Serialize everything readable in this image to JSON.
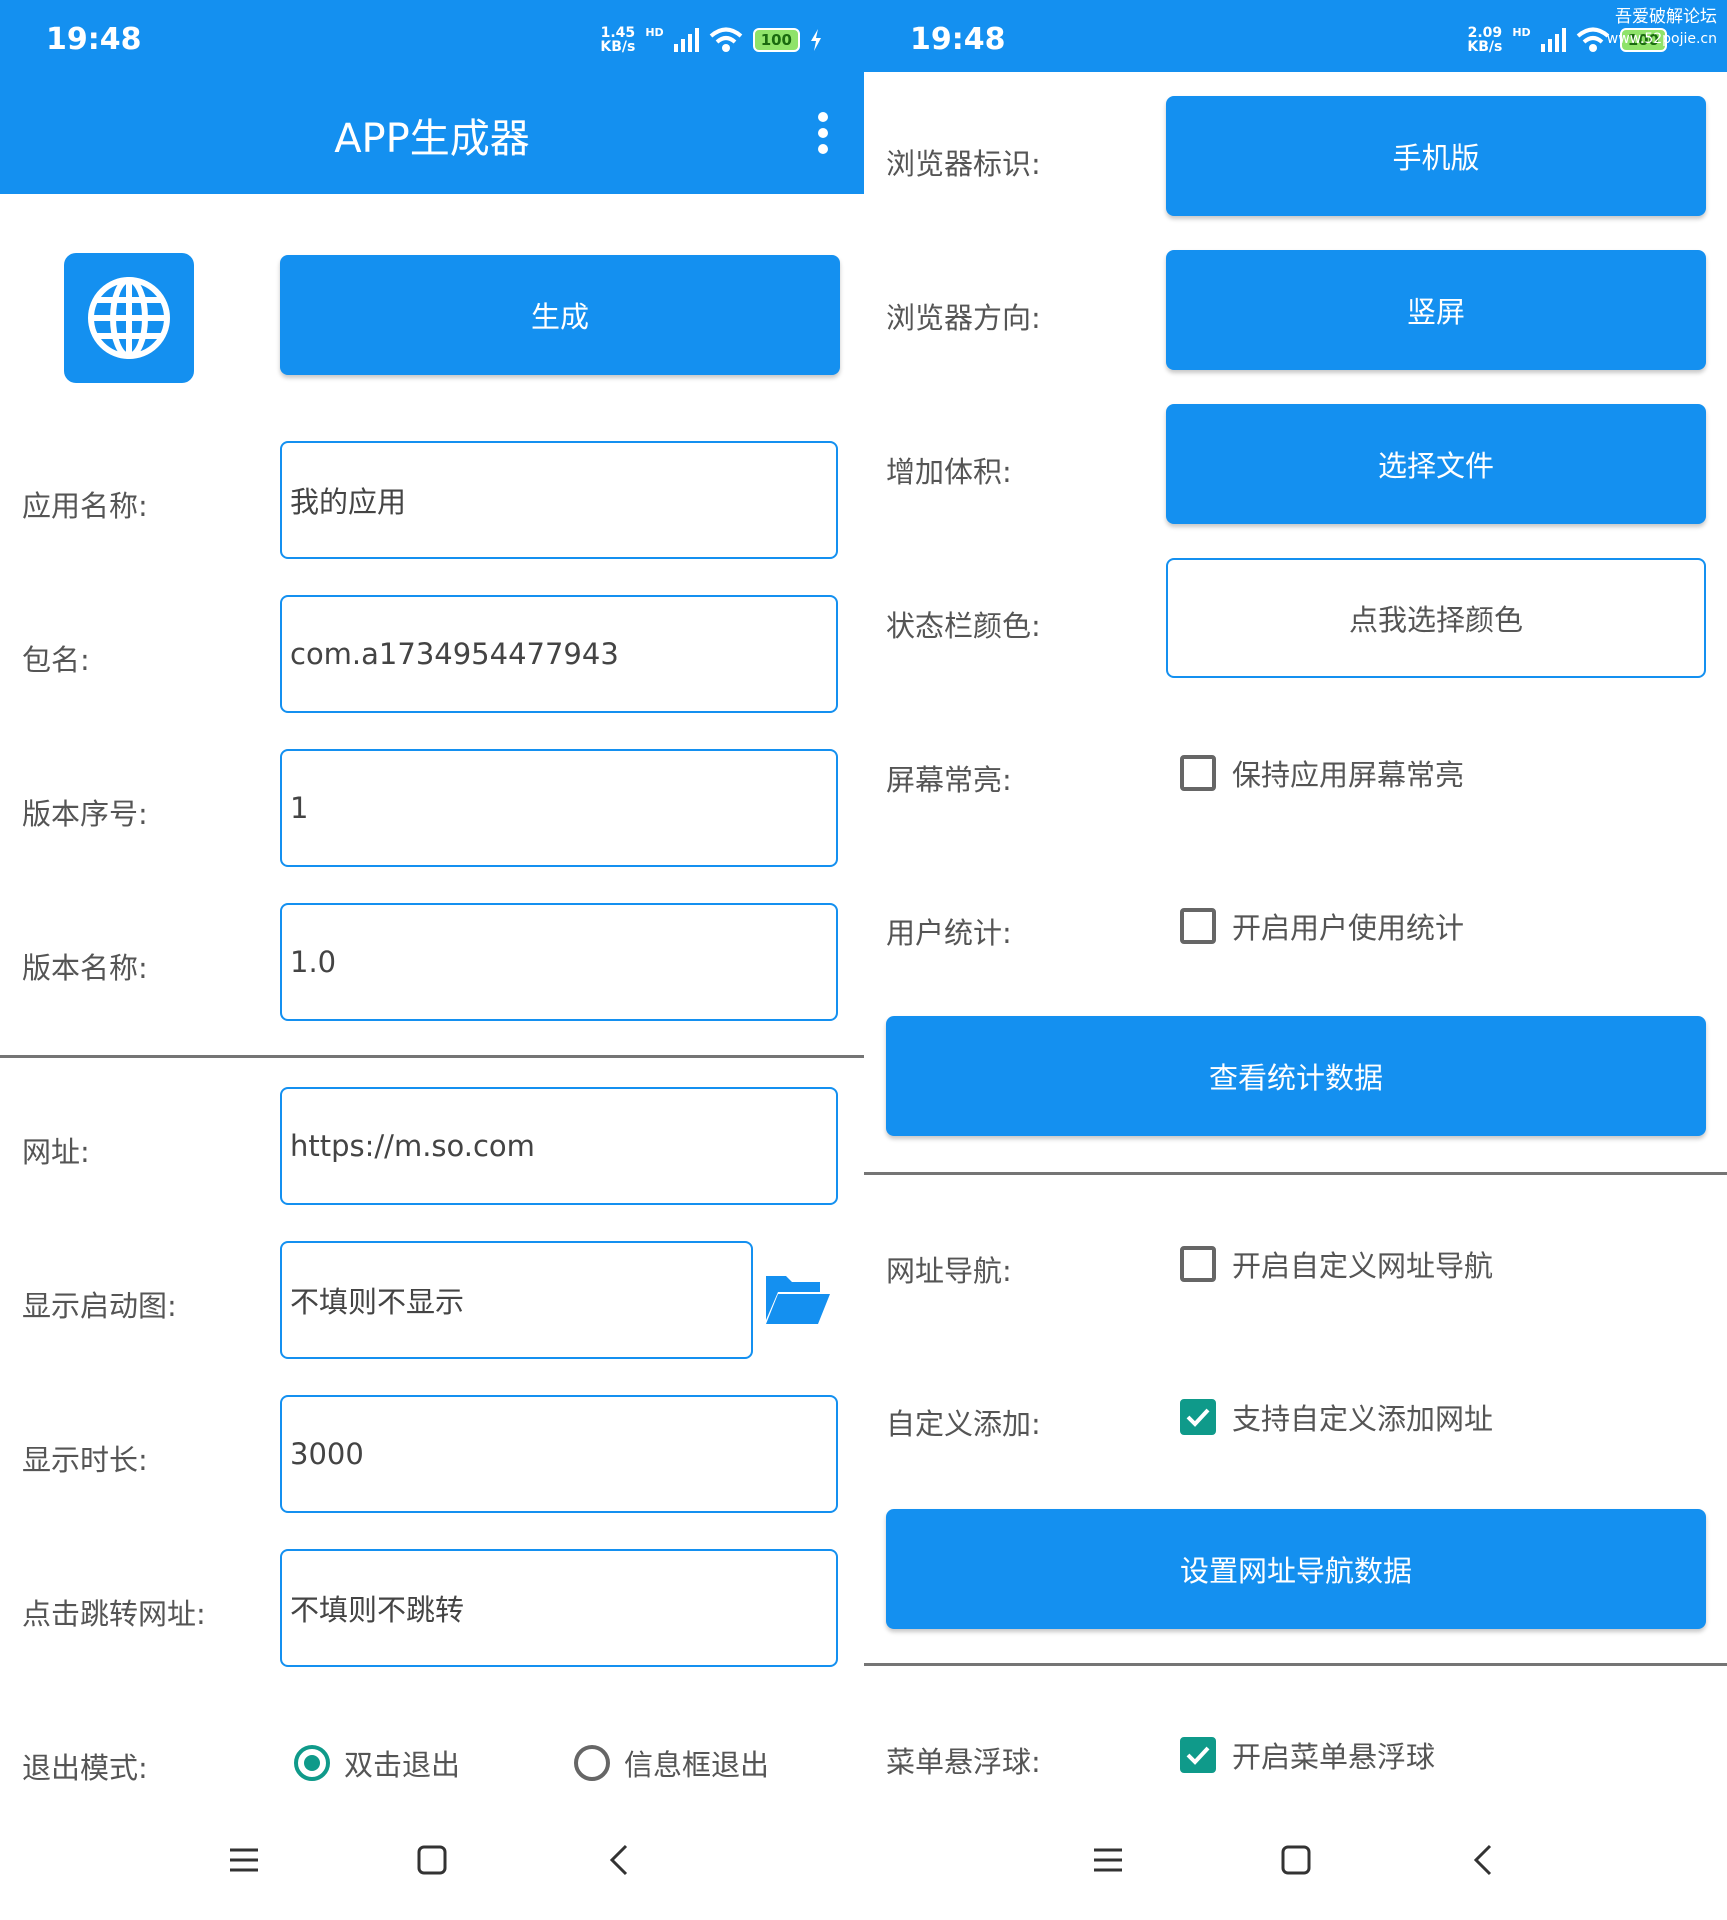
{
  "status_bar": {
    "left": {
      "time": "19:48",
      "speed_value": "1.45",
      "speed_unit": "KB/s",
      "hd": "HD",
      "battery": "100"
    },
    "right": {
      "time": "19:48",
      "speed_value": "2.09",
      "speed_unit": "KB/s",
      "hd": "HD",
      "battery": "100"
    }
  },
  "watermark": {
    "line1": "吾爱破解论坛",
    "line2": "www.52pojie.cn"
  },
  "app_bar": {
    "title": "APP生成器",
    "menu_icon": "more-vert-icon"
  },
  "colors": {
    "primary": "#1490f0",
    "checked": "#0f9a8a",
    "divider": "#757575"
  },
  "left_panel": {
    "app_icon": "globe-icon",
    "generate_button": "生成",
    "fields": [
      {
        "label": "应用名称:",
        "value": "我的应用"
      },
      {
        "label": "包名:",
        "value": "com.a1734954477943"
      },
      {
        "label": "版本序号:",
        "value": "1"
      },
      {
        "label": "版本名称:",
        "value": "1.0"
      },
      {
        "label": "网址:",
        "value": "https://m.so.com"
      },
      {
        "label": "显示启动图:",
        "value": "不填则不显示"
      },
      {
        "label": "显示时长:",
        "value": "3000"
      },
      {
        "label": "点击跳转网址:",
        "value": "不填则不跳转"
      }
    ],
    "folder_icon": "folder-open-icon",
    "exit_mode": {
      "label": "退出模式:",
      "options": [
        {
          "label": "双击退出",
          "selected": true
        },
        {
          "label": "信息框退出",
          "selected": false
        }
      ]
    }
  },
  "right_panel": {
    "browser_ua": {
      "label": "浏览器标识:",
      "button": "手机版"
    },
    "browser_orientation": {
      "label": "浏览器方向:",
      "button": "竖屏"
    },
    "increase_size": {
      "label": "增加体积:",
      "button": "选择文件"
    },
    "status_bar_color": {
      "label": "状态栏颜色:",
      "button": "点我选择颜色"
    },
    "screen_on": {
      "label": "屏幕常亮:",
      "checkbox": "保持应用屏幕常亮",
      "checked": false
    },
    "user_stats": {
      "label": "用户统计:",
      "checkbox": "开启用户使用统计",
      "checked": false
    },
    "view_stats_button": "查看统计数据",
    "url_nav": {
      "label": "网址导航:",
      "checkbox": "开启自定义网址导航",
      "checked": false
    },
    "custom_add": {
      "label": "自定义添加:",
      "checkbox": "支持自定义添加网址",
      "checked": true
    },
    "set_nav_button": "设置网址导航数据",
    "menu_float": {
      "label": "菜单悬浮球:",
      "checkbox": "开启菜单悬浮球",
      "checked": true
    }
  },
  "nav_bar": {
    "icons": [
      "menu-icon",
      "home-icon",
      "back-icon"
    ]
  }
}
